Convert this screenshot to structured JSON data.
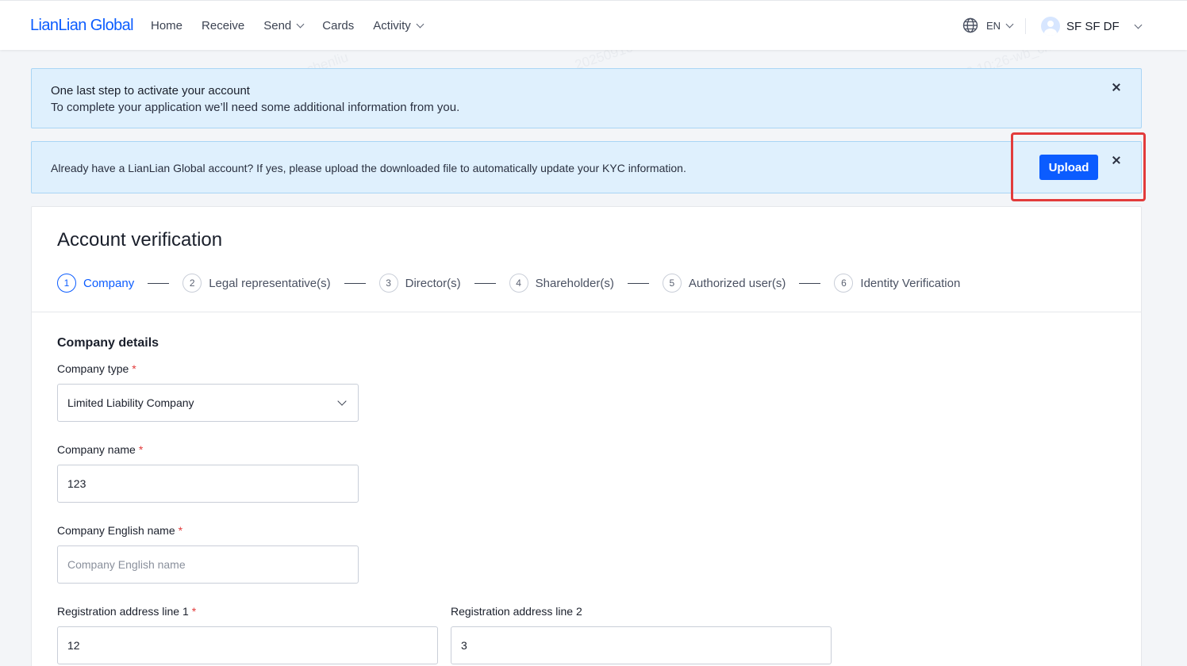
{
  "header": {
    "logo": "LianLian Global",
    "nav": [
      "Home",
      "Receive",
      "Send",
      "Cards",
      "Activity"
    ],
    "lang": "EN",
    "user_name": "SF SF DF"
  },
  "banner1": {
    "title": "One last step to activate your account",
    "subtitle": "To complete your application we’ll need some additional information from you."
  },
  "banner2": {
    "text": "Already have a LianLian Global account? If yes, please upload the downloaded file to automatically update your KYC information.",
    "upload_label": "Upload"
  },
  "card": {
    "title": "Account verification",
    "steps": [
      {
        "num": "1",
        "label": "Company"
      },
      {
        "num": "2",
        "label": "Legal representative(s)"
      },
      {
        "num": "3",
        "label": "Director(s)"
      },
      {
        "num": "4",
        "label": "Shareholder(s)"
      },
      {
        "num": "5",
        "label": "Authorized user(s)"
      },
      {
        "num": "6",
        "label": "Identity Verification"
      }
    ],
    "section_title": "Company details",
    "fields": {
      "company_type": {
        "label": "Company type",
        "value": "Limited Liability Company"
      },
      "company_name": {
        "label": "Company name",
        "value": "123"
      },
      "company_english_name": {
        "label": "Company English name",
        "placeholder": "Company English name"
      },
      "address_line_1": {
        "label": "Registration address line 1",
        "value": "12"
      },
      "address_line_2": {
        "label": "Registration address line 2",
        "value": "3"
      }
    },
    "required_mark": "*"
  },
  "watermark": "20250916 10:26-wb_chenliu",
  "colors": {
    "accent": "#0b5cff",
    "banner_bg": "#dff0fd",
    "highlight": "#e23b3b"
  }
}
